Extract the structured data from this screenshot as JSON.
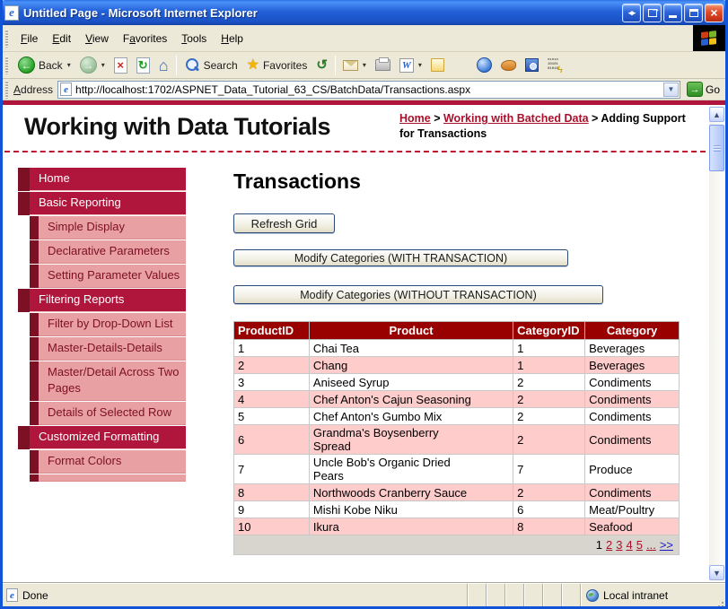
{
  "window": {
    "title": "Untitled Page - Microsoft Internet Explorer",
    "controls": [
      "arrows-horizontal",
      "popout",
      "minimize",
      "maximize",
      "close"
    ]
  },
  "menu": {
    "items": [
      {
        "label": "File",
        "accel": 0
      },
      {
        "label": "Edit",
        "accel": 0
      },
      {
        "label": "View",
        "accel": 0
      },
      {
        "label": "Favorites",
        "accel": 1
      },
      {
        "label": "Tools",
        "accel": 0
      },
      {
        "label": "Help",
        "accel": 0
      }
    ]
  },
  "toolbar": {
    "back_label": "Back",
    "search_label": "Search",
    "favorites_label": "Favorites",
    "icons": [
      "back-icon",
      "forward-icon",
      "stop-icon",
      "refresh-icon",
      "home-icon",
      "search-icon",
      "favorites-star-icon",
      "history-icon",
      "mail-icon",
      "print-icon",
      "edit-word-icon",
      "discuss-notes-icon",
      "messenger-icon",
      "research-icon",
      "book-search-icon",
      "binary-tool-icon"
    ]
  },
  "address": {
    "label": "Address",
    "url": "http://localhost:1702/ASPNET_Data_Tutorial_63_CS/BatchData/Transactions.aspx",
    "go_label": "Go"
  },
  "header": {
    "site_title": "Working with Data Tutorials",
    "breadcrumb": [
      {
        "label": "Home",
        "link": true
      },
      {
        "label": "Working with Batched Data",
        "link": true
      },
      {
        "label": "Adding Support for Transactions",
        "link": false
      }
    ],
    "separator": ">"
  },
  "sidebar": {
    "items": [
      {
        "label": "Home",
        "level": 1
      },
      {
        "label": "Basic Reporting",
        "level": 1
      },
      {
        "label": "Simple Display",
        "level": 2
      },
      {
        "label": "Declarative Parameters",
        "level": 2
      },
      {
        "label": "Setting Parameter Values",
        "level": 2
      },
      {
        "label": "Filtering Reports",
        "level": 1
      },
      {
        "label": "Filter by Drop-Down List",
        "level": 2
      },
      {
        "label": "Master-Details-Details",
        "level": 2
      },
      {
        "label": "Master/Detail Across Two Pages",
        "level": 2
      },
      {
        "label": "Details of Selected Row",
        "level": 2
      },
      {
        "label": "Customized Formatting",
        "level": 1
      },
      {
        "label": "Format Colors",
        "level": 2
      },
      {
        "label": "",
        "level": 2,
        "partial": true
      }
    ]
  },
  "main": {
    "page_title": "Transactions",
    "buttons": {
      "refresh": "Refresh Grid",
      "with_transaction": "Modify Categories (WITH TRANSACTION)",
      "without_transaction": "Modify Categories (WITHOUT TRANSACTION)"
    },
    "table": {
      "columns": [
        "ProductID",
        "Product",
        "CategoryID",
        "Category"
      ],
      "rows": [
        [
          "1",
          "Chai Tea",
          "1",
          "Beverages"
        ],
        [
          "2",
          "Chang",
          "1",
          "Beverages"
        ],
        [
          "3",
          "Aniseed Syrup",
          "2",
          "Condiments"
        ],
        [
          "4",
          "Chef Anton's Cajun Seasoning",
          "2",
          "Condiments"
        ],
        [
          "5",
          "Chef Anton's Gumbo Mix",
          "2",
          "Condiments"
        ],
        [
          "6",
          "Grandma's Boysenberry Spread",
          "2",
          "Condiments"
        ],
        [
          "7",
          "Uncle Bob's Organic Dried Pears",
          "7",
          "Produce"
        ],
        [
          "8",
          "Northwoods Cranberry Sauce",
          "2",
          "Condiments"
        ],
        [
          "9",
          "Mishi Kobe Niku",
          "6",
          "Meat/Poultry"
        ],
        [
          "10",
          "Ikura",
          "8",
          "Seafood"
        ]
      ],
      "pager": {
        "current": "1",
        "links": [
          "2",
          "3",
          "4",
          "5",
          "..."
        ],
        "next": ">>"
      }
    }
  },
  "statusbar": {
    "status": "Done",
    "zone": "Local intranet"
  },
  "colors": {
    "titlebar_blue": "#2360d8",
    "crimson": "#b0153c",
    "maroon": "#7c1024",
    "salmon": "#e8a0a2",
    "table_header_red": "#990000",
    "row_pink": "#ffcccc",
    "pager_gray": "#d8d5cf",
    "link_red": "#a8102c",
    "next_link_blue": "#1818c8",
    "toolbar_beige": "#ece9d8"
  }
}
